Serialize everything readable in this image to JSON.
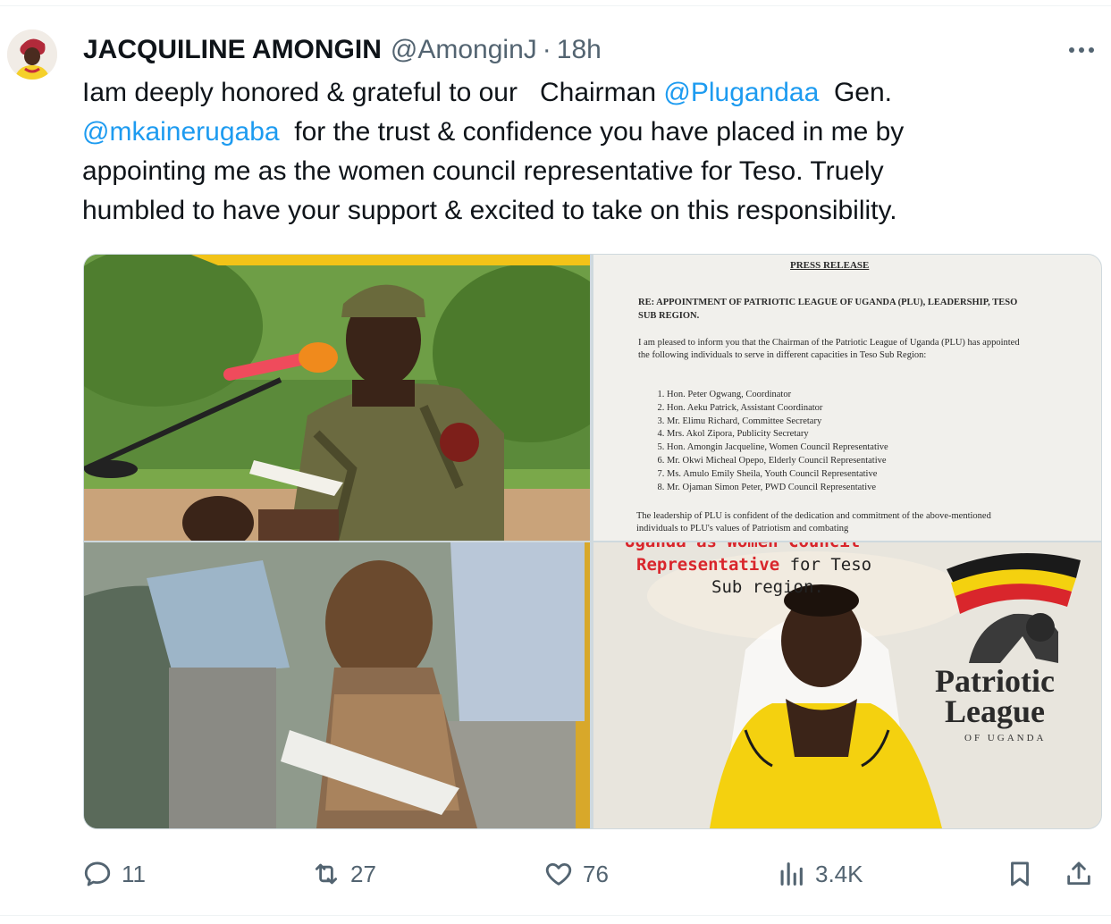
{
  "tweet": {
    "author_name": "JACQUILINE AMONGIN",
    "handle": "@AmonginJ",
    "separator": "·",
    "time": "18h",
    "text_lines": [
      [
        {
          "t": "Iam deeply honored & grateful to our   Chairman "
        },
        {
          "t": "@Plugandaa",
          "m": true
        },
        {
          "t": "  Gen."
        }
      ],
      [
        {
          "t": "@mkainerugaba",
          "m": true
        },
        {
          "t": "  for the trust & confidence you have placed in me by"
        }
      ],
      [
        {
          "t": "appointing me as the women council representative for Teso. Truely"
        }
      ],
      [
        {
          "t": "humbled to have your support & excited to take on this responsibility."
        }
      ]
    ]
  },
  "press_release": {
    "title": "PRESS RELEASE",
    "re": "RE:  APPOINTMENT  OF  PATRIOTIC  LEAGUE  OF  UGANDA  (PLU), LEADERSHIP, TESO SUB REGION.",
    "intro": "I am pleased to inform you that the Chairman of the Patriotic League of Uganda (PLU) has appointed the following individuals to serve in different capacities in Teso Sub Region:",
    "list": [
      "Hon. Peter Ogwang, Coordinator",
      "Hon. Aeku Patrick, Assistant Coordinator",
      "Mr. Elimu Richard, Committee Secretary",
      "Mrs. Akol Zipora, Publicity Secretary",
      "Hon. Amongin Jacqueline, Women Council Representative",
      "Mr. Okwi Micheal Opepo, Elderly Council Representative",
      "Ms. Amulo Emily Sheila, Youth Council Representative",
      "Mr. Ojaman Simon Peter, PWD Council Representative"
    ],
    "tail": "The leadership of PLU is confident of the dedication and commitment of the above-mentioned individuals to PLU's values of Patriotism and combating"
  },
  "poster": {
    "line1": "Uganda as Women Council",
    "line2_red": "Representative",
    "line2_rest": " for Teso",
    "line3": "Sub region.",
    "brand_line1": "Patriotic",
    "brand_line2": "League",
    "brand_sub": "OF UGANDA"
  },
  "stats": {
    "replies": "11",
    "reposts": "27",
    "likes": "76",
    "views": "3.4K"
  },
  "colors": {
    "text": "#0f1419",
    "muted": "#536471",
    "link": "#1d9bf0",
    "border": "#cfd9de",
    "poster_red": "#d9262c"
  }
}
